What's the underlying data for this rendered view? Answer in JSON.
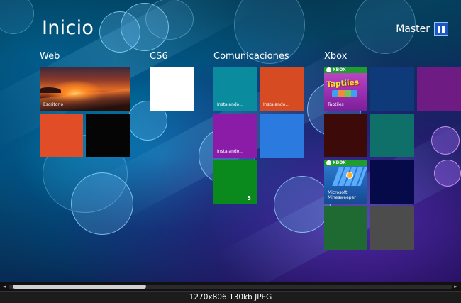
{
  "start_screen": {
    "title": "Inicio",
    "user": {
      "name": "Master"
    }
  },
  "groups": [
    {
      "name": "Web",
      "tiles": [
        {
          "caption": "Escritorio",
          "kind": "desktop-wallpaper"
        },
        {
          "color": "#e04d27"
        },
        {
          "color": "#050505"
        }
      ]
    },
    {
      "name": "CS6",
      "tiles": [
        {
          "color": "#ffffff"
        }
      ]
    },
    {
      "name": "Comunicaciones",
      "tiles": [
        {
          "caption": "Instalando...",
          "color": "#0a8c9e"
        },
        {
          "caption": "Instalando...",
          "color": "#d64b22"
        },
        {
          "caption": "Instalando...",
          "color": "#8a1ca8"
        },
        {
          "color": "#2a7ae0"
        },
        {
          "count": "5",
          "color": "#0a8a1c"
        }
      ]
    },
    {
      "name": "Xbox",
      "tiles": [
        {
          "badge": "XBOX",
          "caption": "Taptiles",
          "logo": "Taptiles"
        },
        {
          "color": "#0e3a7a"
        },
        {
          "color": "#6e1c84"
        },
        {
          "color": "#3c0a08"
        },
        {
          "color": "#0e7068"
        },
        {
          "badge": "XBOX",
          "caption": "Microsoft\nMinesweeper"
        },
        {
          "color": "#060a48"
        },
        {
          "color": "#1e6a32"
        },
        {
          "color": "#4c4c4c"
        }
      ]
    }
  ],
  "scrollbar": {
    "left_arrow": "◄",
    "right_arrow": "►"
  },
  "image_caption": "1270x806  130kb  JPEG"
}
